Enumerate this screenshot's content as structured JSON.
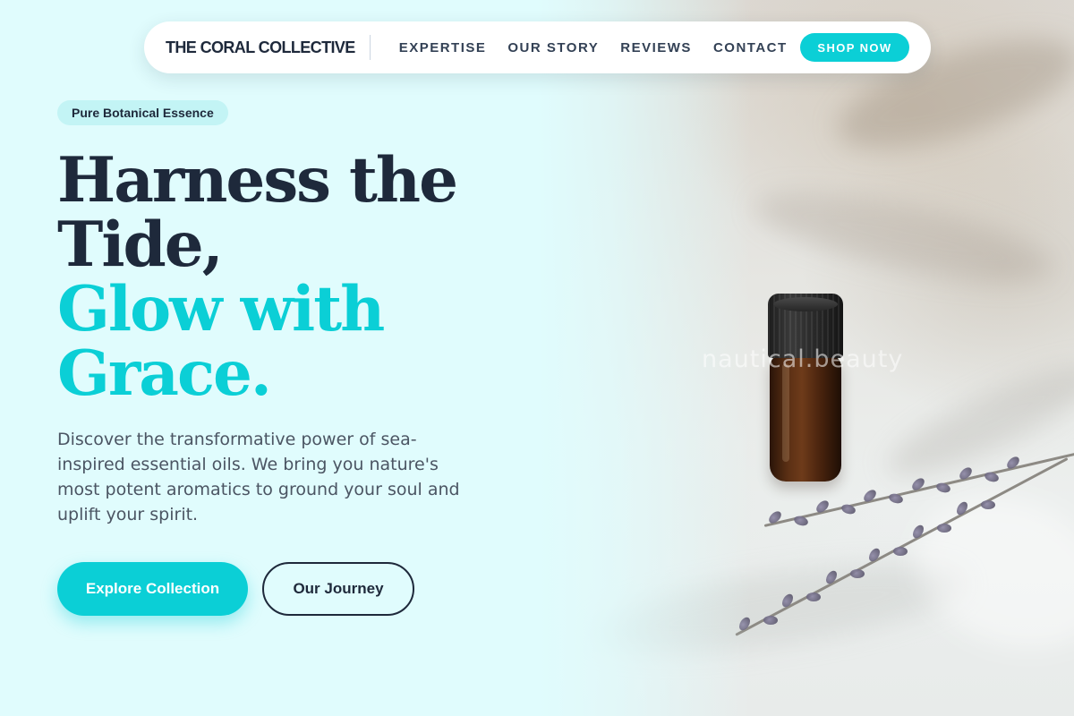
{
  "colors": {
    "background": "#e0fcfd",
    "accent": "#0bcfd6",
    "text_dark": "#1e293b",
    "text_muted": "#4b5563",
    "badge_background": "#c3f4f5"
  },
  "navbar": {
    "brand": "THE CORAL COLLECTIVE",
    "links": [
      "EXPERTISE",
      "OUR STORY",
      "REVIEWS",
      "CONTACT"
    ],
    "cta_label": "SHOP NOW"
  },
  "hero": {
    "badge": "Pure Botanical Essence",
    "headline_dark": [
      "Harness the",
      "Tide,"
    ],
    "headline_accent": [
      "Glow with",
      "Grace."
    ],
    "description": "Discover the transformative power of sea-inspired essential oils. We bring you nature's most potent aromatics to ground your soul and uplift your spirit.",
    "primary_button": "Explore Collection",
    "secondary_button": "Our Journey"
  },
  "image": {
    "watermark": "nautical.beauty",
    "subject_icons": [
      "essential-oil-bottle-icon",
      "lavender-sprig-icon"
    ]
  }
}
